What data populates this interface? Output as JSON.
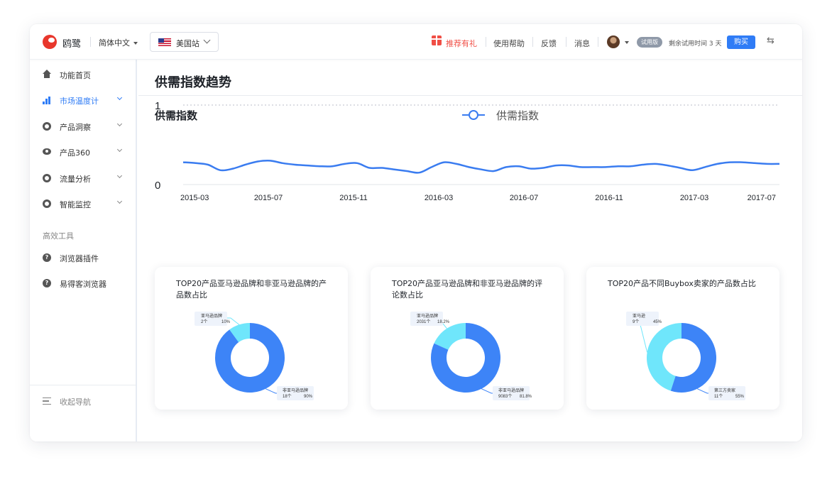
{
  "header": {
    "brand": "鸥鹭",
    "language": "简体中文",
    "site": "美国站",
    "links": [
      "推荐有礼",
      "使用帮助",
      "反馈",
      "消息"
    ],
    "trial_badge": "试用版",
    "trial_text": "剩余试用时间 3 天",
    "buy_label": "购买",
    "accent_color": "#2f7cf6",
    "promo_color": "#f04e45"
  },
  "sidebar": {
    "items": [
      {
        "label": "功能首页",
        "icon": "home-icon"
      },
      {
        "label": "市场温度计",
        "icon": "bar-chart-icon",
        "active": true
      },
      {
        "label": "产品洞察",
        "icon": "disc-icon"
      },
      {
        "label": "产品360",
        "icon": "eye-icon"
      },
      {
        "label": "流量分析",
        "icon": "disc-icon"
      },
      {
        "label": "智能监控",
        "icon": "disc-icon"
      }
    ],
    "tools_title": "高效工具",
    "tools": [
      {
        "label": "浏览器插件",
        "icon": "help-circle-icon"
      },
      {
        "label": "易得客浏览器",
        "icon": "help-circle-icon"
      }
    ],
    "collapse_label": "收起导航"
  },
  "main": {
    "title": "供需指数趋势"
  },
  "chart_data": [
    {
      "type": "line",
      "title": "供需指数",
      "series": [
        {
          "name": "供需指数",
          "color": "#3a7cf0",
          "values": [
            0.28,
            0.27,
            0.25,
            0.18,
            0.2,
            0.25,
            0.29,
            0.3,
            0.27,
            0.25,
            0.24,
            0.23,
            0.23,
            0.26,
            0.27,
            0.21,
            0.21,
            0.19,
            0.17,
            0.15,
            0.22,
            0.28,
            0.26,
            0.22,
            0.19,
            0.17,
            0.22,
            0.23,
            0.2,
            0.21,
            0.24,
            0.24,
            0.22,
            0.22,
            0.22,
            0.23,
            0.23,
            0.25,
            0.26,
            0.24,
            0.21,
            0.18,
            0.22,
            0.26,
            0.28,
            0.28,
            0.27,
            0.26,
            0.26
          ]
        }
      ],
      "x_tick_labels": [
        "2015-03",
        "2015-07",
        "2015-11",
        "2016-03",
        "2016-07",
        "2016-11",
        "2017-03",
        "2017-07"
      ],
      "ylim": [
        0,
        1
      ],
      "y_tick_labels": [
        "0",
        "1"
      ],
      "legend": "top-center",
      "grid": "dotted top line"
    },
    {
      "type": "pie",
      "title": "TOP20产品亚马逊品牌和非亚马逊品牌的产品数占比",
      "slices": [
        {
          "label": "亚马逊品牌",
          "count": "2个",
          "percent": "10%",
          "value": 10,
          "color": "#6fe6fb"
        },
        {
          "label": "非亚马逊品牌",
          "count": "18个",
          "percent": "90%",
          "value": 90,
          "color": "#3d84f7"
        }
      ]
    },
    {
      "type": "pie",
      "title": "TOP20产品亚马逊品牌和非亚马逊品牌的评论数占比",
      "slices": [
        {
          "label": "亚马逊品牌",
          "count": "2031个",
          "percent": "18.2%",
          "value": 18.2,
          "color": "#6fe6fb"
        },
        {
          "label": "非亚马逊品牌",
          "count": "9083个",
          "percent": "81.8%",
          "value": 81.8,
          "color": "#3d84f7"
        }
      ]
    },
    {
      "type": "pie",
      "title": "TOP20产品不同Buybox卖家的产品数占比",
      "slices": [
        {
          "label": "亚马逊",
          "count": "9个",
          "percent": "45%",
          "value": 45,
          "color": "#6fe6fb"
        },
        {
          "label": "第三方卖家",
          "count": "11个",
          "percent": "55%",
          "value": 55,
          "color": "#3d84f7"
        }
      ]
    }
  ]
}
